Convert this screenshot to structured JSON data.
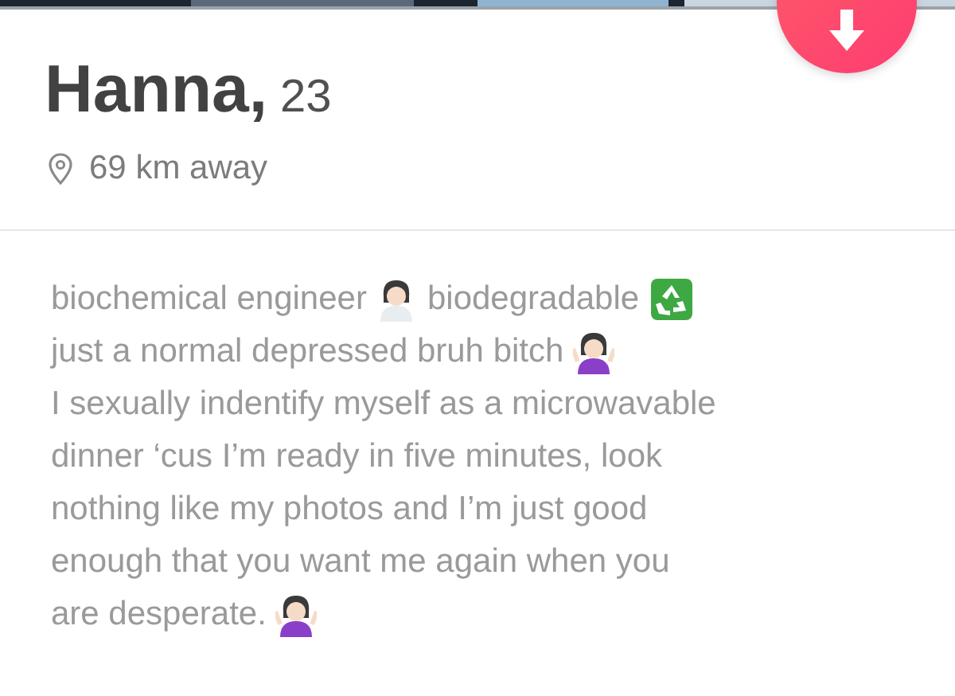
{
  "profile": {
    "name": "Hanna,",
    "age": "23",
    "distance": "69 km away"
  },
  "bio": [
    [
      {
        "kind": "text",
        "text": "biochemical engineer"
      },
      {
        "kind": "scientist"
      },
      {
        "kind": "text",
        "text": "biodegradable"
      },
      {
        "kind": "recycle"
      }
    ],
    [
      {
        "kind": "text",
        "text": "just a normal depressed bruh bitch"
      },
      {
        "kind": "shrug"
      }
    ],
    [
      {
        "kind": "text",
        "text": "I sexually indentify myself as a microwavable"
      }
    ],
    [
      {
        "kind": "text",
        "text": "dinner ‘cus I’m ready in five minutes, look"
      }
    ],
    [
      {
        "kind": "text",
        "text": "nothing like my photos and I’m just good"
      }
    ],
    [
      {
        "kind": "text",
        "text": "enough that you want me again when you"
      }
    ],
    [
      {
        "kind": "text",
        "text": "are desperate."
      },
      {
        "kind": "shrug"
      }
    ]
  ]
}
